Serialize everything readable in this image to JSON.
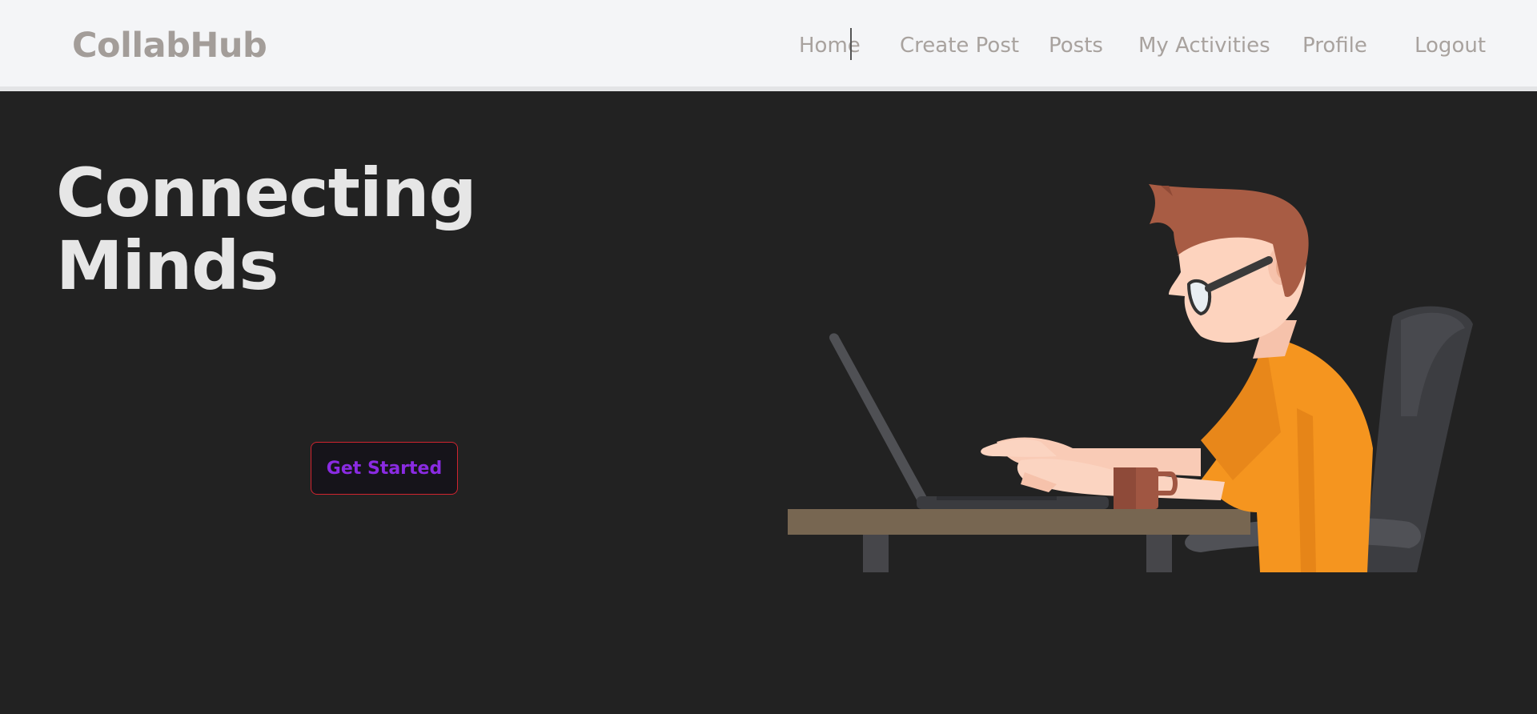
{
  "header": {
    "brand": "CollabHub",
    "nav": [
      {
        "label": "Home"
      },
      {
        "label": "Create Post"
      },
      {
        "label": "Posts"
      },
      {
        "label": "My Activities"
      },
      {
        "label": "Profile"
      },
      {
        "label": "Logout"
      }
    ]
  },
  "hero": {
    "title_line1": "Connecting",
    "title_line2": "Minds",
    "cta_label": "Get Started"
  },
  "colors": {
    "background": "#222222",
    "navbar": "#f4f5f7",
    "cta_text": "#8a2be2",
    "cta_border": "#d0242f"
  },
  "illustration": {
    "description_icon": "person-at-laptop-illustration"
  }
}
